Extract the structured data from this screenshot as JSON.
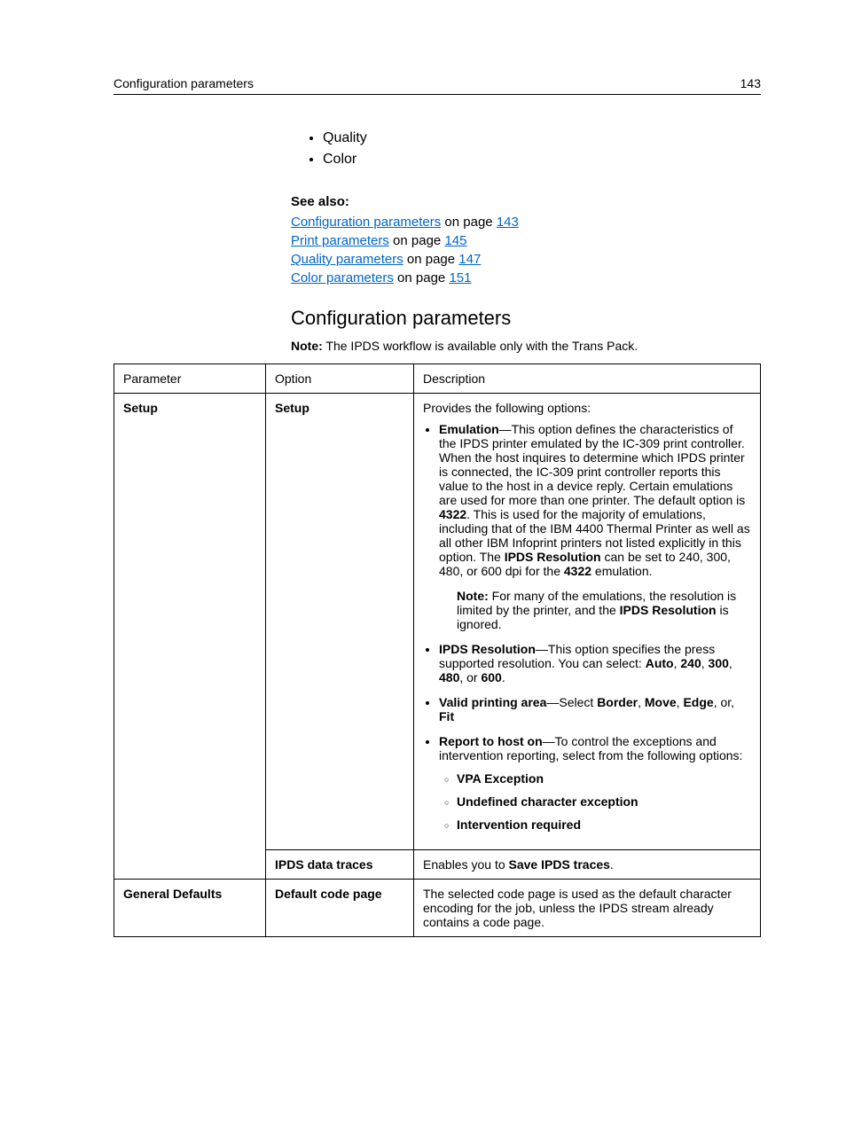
{
  "header": {
    "left": "Configuration parameters",
    "right": "143"
  },
  "top_bullets": [
    "Quality",
    "Color"
  ],
  "see_also": {
    "title": "See also:",
    "items": [
      {
        "link_text": "Configuration parameters",
        "connector": " on page ",
        "page": "143"
      },
      {
        "link_text": "Print parameters",
        "connector": " on page ",
        "page": "145"
      },
      {
        "link_text": "Quality parameters",
        "connector": " on page ",
        "page": "147"
      },
      {
        "link_text": "Color parameters",
        "connector": " on page ",
        "page": "151"
      }
    ]
  },
  "section": {
    "title": "Configuration parameters",
    "note_label": "Note:",
    "note_text": " The IPDS workflow is available only with the Trans Pack."
  },
  "table": {
    "headers": {
      "param": "Parameter",
      "option": "Option",
      "desc": "Description"
    },
    "rows": {
      "setup": {
        "param": "Setup",
        "option": "Setup",
        "intro": "Provides the following options:",
        "emulation_label": "Emulation",
        "emulation_text_1": "—This option defines the characteristics of the IPDS printer emulated by the IC-309 print controller. When the host inquires to determine which IPDS printer is connected, the IC-309 print controller reports this value to the host in a device reply. Certain emulations are used for more than one printer. The default option is ",
        "emulation_bold_4322": "4322",
        "emulation_text_2": ". This is used for the majority of emulations, including that of the IBM 4400 Thermal Printer as well as all other IBM Infoprint printers not listed explicitly in this option. The ",
        "emulation_bold_res": "IPDS Resolution",
        "emulation_text_3": " can be set to 240, 300, 480, or 600 dpi for the ",
        "emulation_bold_4322b": "4322",
        "emulation_text_4": " emulation.",
        "note_label": "Note:",
        "note_text_1": " For many of the emulations, the resolution is limited by the printer, and the ",
        "note_bold": "IPDS Resolution",
        "note_text_2": " is ignored.",
        "ipdsres_label": "IPDS Resolution",
        "ipdsres_text_1": "—This option specifies the press supported resolution. You can select: ",
        "ipdsres_b_auto": "Auto",
        "ipdsres_sep": ", ",
        "ipdsres_b_240": "240",
        "ipdsres_b_300": "300",
        "ipdsres_b_480": "480",
        "ipdsres_or": ", or ",
        "ipdsres_b_600": "600",
        "ipdsres_end": ".",
        "valid_label": "Valid printing area",
        "valid_text_1": "—Select ",
        "valid_b_border": "Border",
        "valid_b_move": "Move",
        "valid_b_edge": "Edge",
        "valid_or": ", or, ",
        "valid_b_fit": "Fit",
        "report_label": "Report to host on",
        "report_text": "—To control the exceptions and intervention reporting, select from the following options:",
        "sub_vpa": "VPA Exception",
        "sub_undef": "Undefined character exception",
        "sub_interv": "Intervention required"
      },
      "ipds_traces": {
        "option": "IPDS data traces",
        "desc_1": "Enables you to ",
        "desc_bold": "Save IPDS traces",
        "desc_2": "."
      },
      "general_defaults": {
        "param": "General Defaults",
        "option": "Default code page",
        "desc": "The selected code page is used as the default character encoding for the job, unless the IPDS stream already contains a code page."
      }
    }
  }
}
